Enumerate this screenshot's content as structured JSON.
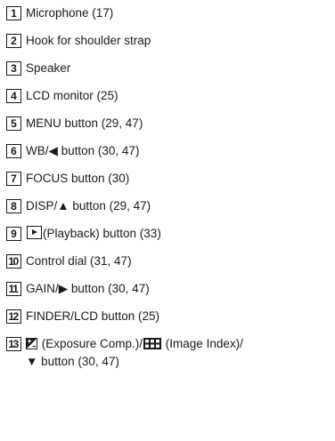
{
  "items": [
    {
      "num": "1",
      "text": "Microphone (17)"
    },
    {
      "num": "2",
      "text": "Hook for shoulder strap"
    },
    {
      "num": "3",
      "text": "Speaker"
    },
    {
      "num": "4",
      "text": "LCD monitor (25)"
    },
    {
      "num": "5",
      "text": "MENU button (29, 47)"
    },
    {
      "num": "6",
      "text": "WB/◀ button (30, 47)"
    },
    {
      "num": "7",
      "text": "FOCUS button (30)"
    },
    {
      "num": "8",
      "text": "DISP/▲ button (29, 47)"
    },
    {
      "num": "9",
      "text": " (Playback) button (33)"
    },
    {
      "num": "10",
      "text": "Control dial (31, 47)"
    },
    {
      "num": "11",
      "text": "GAIN/▶ button (30, 47)"
    },
    {
      "num": "12",
      "text": "FINDER/LCD button (25)"
    },
    {
      "num": "13",
      "text_a": " (Exposure Comp.)/",
      "text_b": " (Image Index)/",
      "text_c": "▼ button (30, 47)"
    }
  ]
}
